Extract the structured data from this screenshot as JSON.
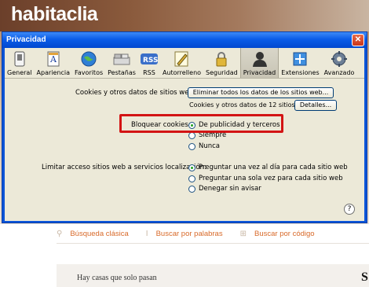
{
  "site": {
    "logo": "habitaclia",
    "nav": [
      {
        "icon": "search-icon",
        "label": "Búsqueda clásica"
      },
      {
        "icon": "text-cursor-icon",
        "label": "Buscar por palabras"
      },
      {
        "icon": "grid-icon",
        "label": "Buscar por código"
      }
    ],
    "quote_line1": "Hay casas que solo pasan",
    "quote_line2": "",
    "accent_color": "#d86a2a"
  },
  "dialog": {
    "title": "Privacidad",
    "close_label": "✕",
    "toolbar": [
      {
        "label": "General",
        "icon": "switch-icon"
      },
      {
        "label": "Apariencia",
        "icon": "document-a-icon"
      },
      {
        "label": "Favoritos",
        "icon": "globe-icon"
      },
      {
        "label": "Pestañas",
        "icon": "tabs-icon"
      },
      {
        "label": "RSS",
        "icon": "rss-icon"
      },
      {
        "label": "Autorrelleno",
        "icon": "pencil-icon"
      },
      {
        "label": "Seguridad",
        "icon": "lock-icon"
      },
      {
        "label": "Privacidad",
        "icon": "person-icon"
      },
      {
        "label": "Extensiones",
        "icon": "puzzle-icon"
      },
      {
        "label": "Avanzado",
        "icon": "gear-icon"
      }
    ],
    "active_tab": "Privacidad",
    "cookies": {
      "label": "Cookies y otros datos de sitios web:",
      "remove_all_button": "Eliminar todos los datos de los sitios web...",
      "count_note": "Cookies y otros datos de 12 sitios web",
      "details_button": "Detalles..."
    },
    "block_cookies": {
      "label": "Bloquear cookies:",
      "options": [
        "De publicidad y terceros",
        "Siempre",
        "Nunca"
      ],
      "selected": "De publicidad y terceros"
    },
    "location": {
      "label": "Limitar acceso sitios web a servicios localización:",
      "options": [
        "Preguntar una vez al día para cada sitio web",
        "Preguntar una sola vez para cada sitio web",
        "Denegar sin avisar"
      ],
      "selected": "Preguntar una vez al día para cada sitio web"
    },
    "help_label": "?",
    "highlight_color": "#d31414"
  }
}
